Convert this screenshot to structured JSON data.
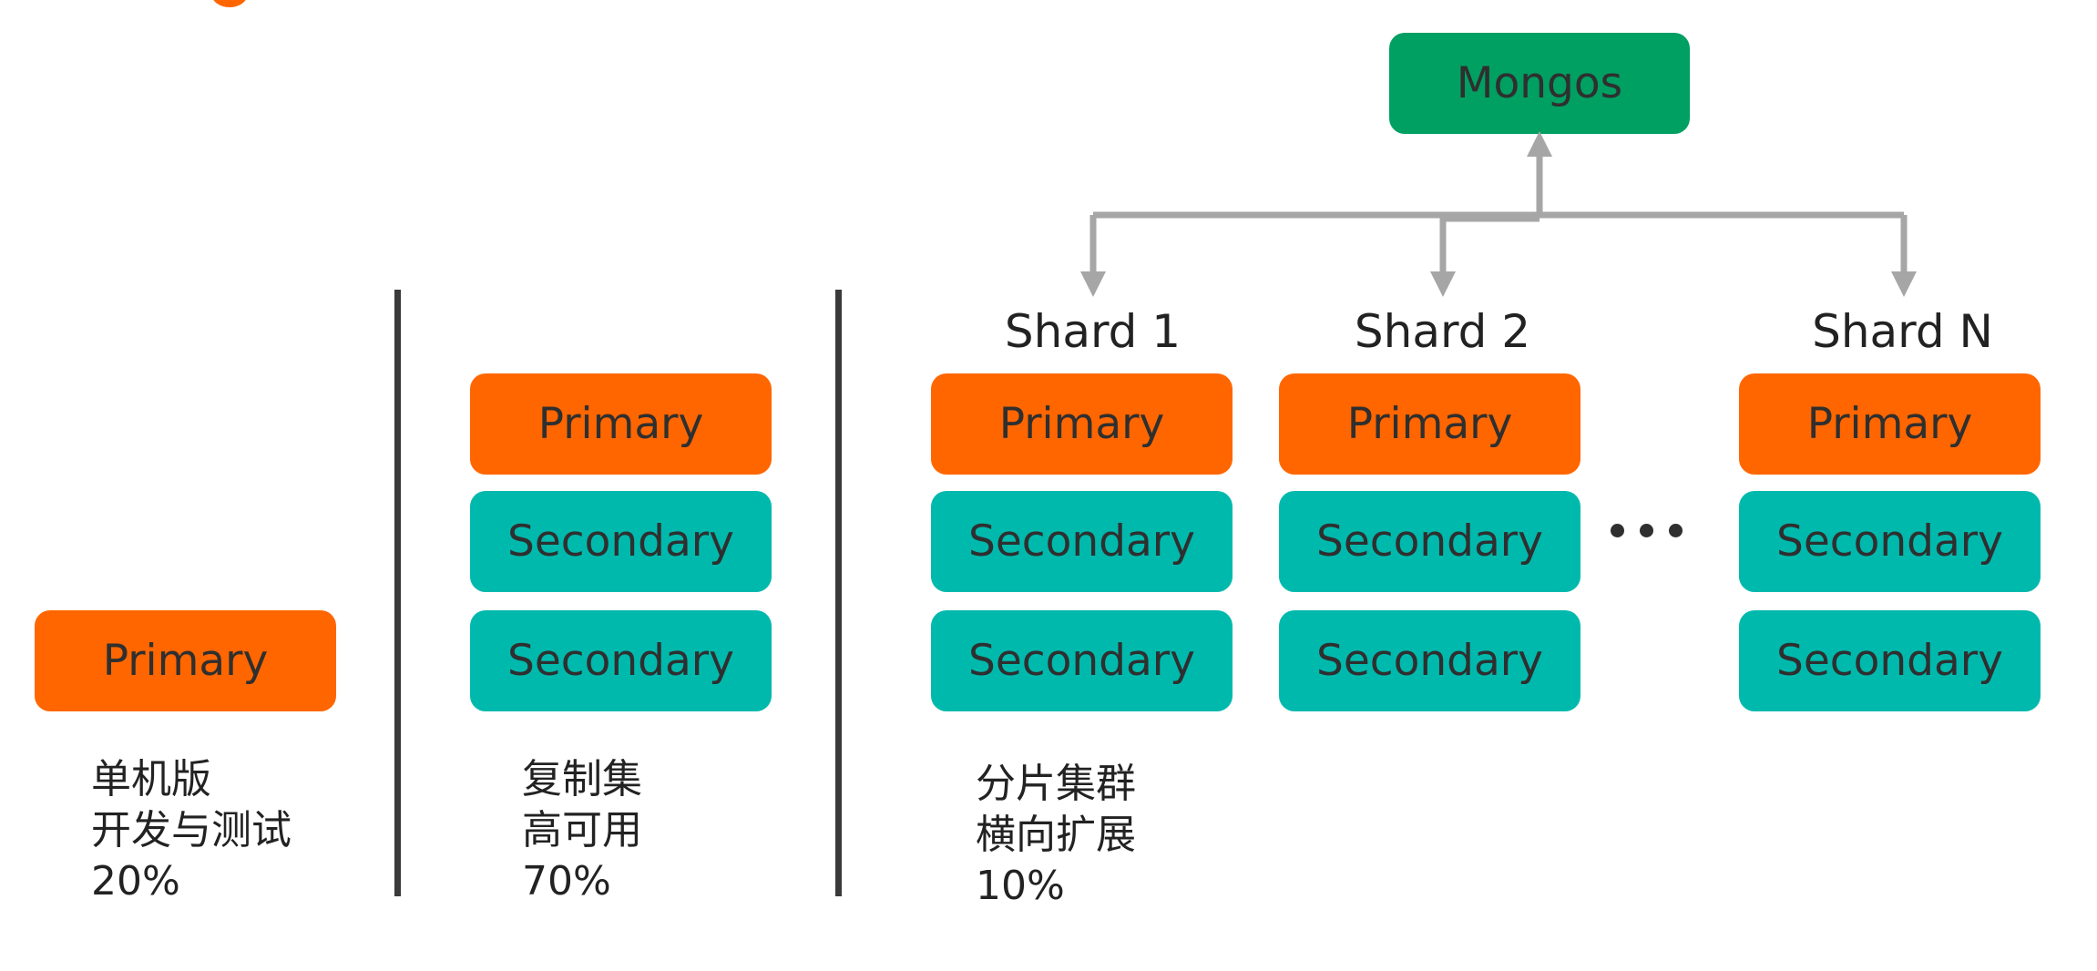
{
  "mongos": {
    "label": "Mongos"
  },
  "standalone": {
    "box": "Primary",
    "caption": [
      "单机版",
      "开发与测试",
      "20%"
    ]
  },
  "replica_set": {
    "boxes": [
      "Primary",
      "Secondary",
      "Secondary"
    ],
    "caption": [
      "复制集",
      "高可用",
      "70%"
    ]
  },
  "sharded_cluster": {
    "shards": [
      {
        "label": "Shard 1",
        "boxes": [
          "Primary",
          "Secondary",
          "Secondary"
        ]
      },
      {
        "label": "Shard 2",
        "boxes": [
          "Primary",
          "Secondary",
          "Secondary"
        ]
      },
      {
        "label": "Shard N",
        "boxes": [
          "Primary",
          "Secondary",
          "Secondary"
        ]
      }
    ],
    "caption": [
      "分片集群",
      "横向扩展",
      "10%"
    ]
  },
  "colors": {
    "primary": "#ff6600",
    "secondary": "#00b9ad",
    "mongos": "#009f62",
    "connector": "#a6a6a6",
    "divider": "#3a3a3a"
  }
}
